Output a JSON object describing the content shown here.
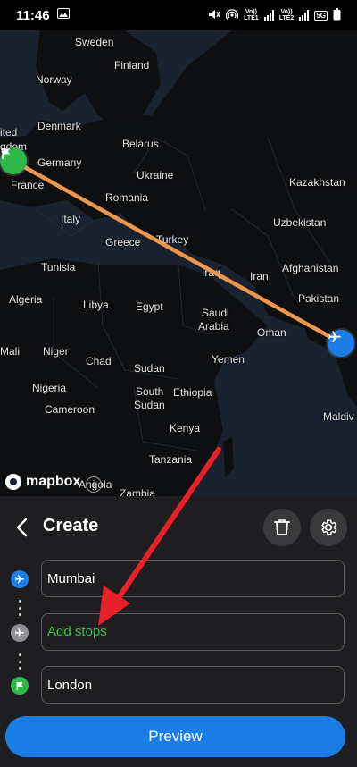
{
  "status_bar": {
    "time": "11:46",
    "lte1": "LTE1",
    "lte2": "LTE2",
    "volte": "Vo))",
    "network": "5G"
  },
  "map": {
    "attribution": "mapbox",
    "info_symbol": "i",
    "labels": [
      {
        "text": "Sweden"
      },
      {
        "text": "Finland"
      },
      {
        "text": "Norway"
      },
      {
        "text": "ited"
      },
      {
        "text": "gdom"
      },
      {
        "text": "Denmark"
      },
      {
        "text": "Belarus"
      },
      {
        "text": "Germany"
      },
      {
        "text": "Ukraine"
      },
      {
        "text": "France"
      },
      {
        "text": "Romania"
      },
      {
        "text": "Kazakhstan"
      },
      {
        "text": "Italy"
      },
      {
        "text": "Uzbekistan"
      },
      {
        "text": "Greece"
      },
      {
        "text": "Turkey"
      },
      {
        "text": "Tunisia"
      },
      {
        "text": "Afghanistan"
      },
      {
        "text": "Iraq"
      },
      {
        "text": "Iran"
      },
      {
        "text": "Algeria"
      },
      {
        "text": "Libya"
      },
      {
        "text": "Egypt"
      },
      {
        "text": "Pakistan"
      },
      {
        "text": "Saudi"
      },
      {
        "text": "Arabia"
      },
      {
        "text": "Oman"
      },
      {
        "text": "Mali"
      },
      {
        "text": "Niger"
      },
      {
        "text": "Chad"
      },
      {
        "text": "Yemen"
      },
      {
        "text": "Sudan"
      },
      {
        "text": "Nigeria"
      },
      {
        "text": "South"
      },
      {
        "text": "Sudan"
      },
      {
        "text": "Ethiopia"
      },
      {
        "text": "Cameroon"
      },
      {
        "text": "Kenya"
      },
      {
        "text": "Maldiv"
      },
      {
        "text": "Tanzania"
      },
      {
        "text": "Angola"
      },
      {
        "text": "Zambia"
      }
    ],
    "route_color": "#f0964a",
    "origin_marker_color": "#1a7ee6",
    "destination_marker_color": "#2fb84a"
  },
  "panel": {
    "title": "Create",
    "stops": [
      {
        "value": "Mumbai",
        "placeholder": "",
        "icon": "airplane-icon",
        "icon_color": "#1a7ee6"
      },
      {
        "value": "",
        "placeholder": "Add stops",
        "icon": "airplane-icon",
        "icon_color": "#8e8e93"
      },
      {
        "value": "London",
        "placeholder": "",
        "icon": "flag-icon",
        "icon_color": "#2fb84a"
      }
    ],
    "preview_label": "Preview"
  },
  "colors": {
    "accent": "#1a7ee6",
    "success": "#3ec14a",
    "annotation_arrow": "#e8202a"
  }
}
